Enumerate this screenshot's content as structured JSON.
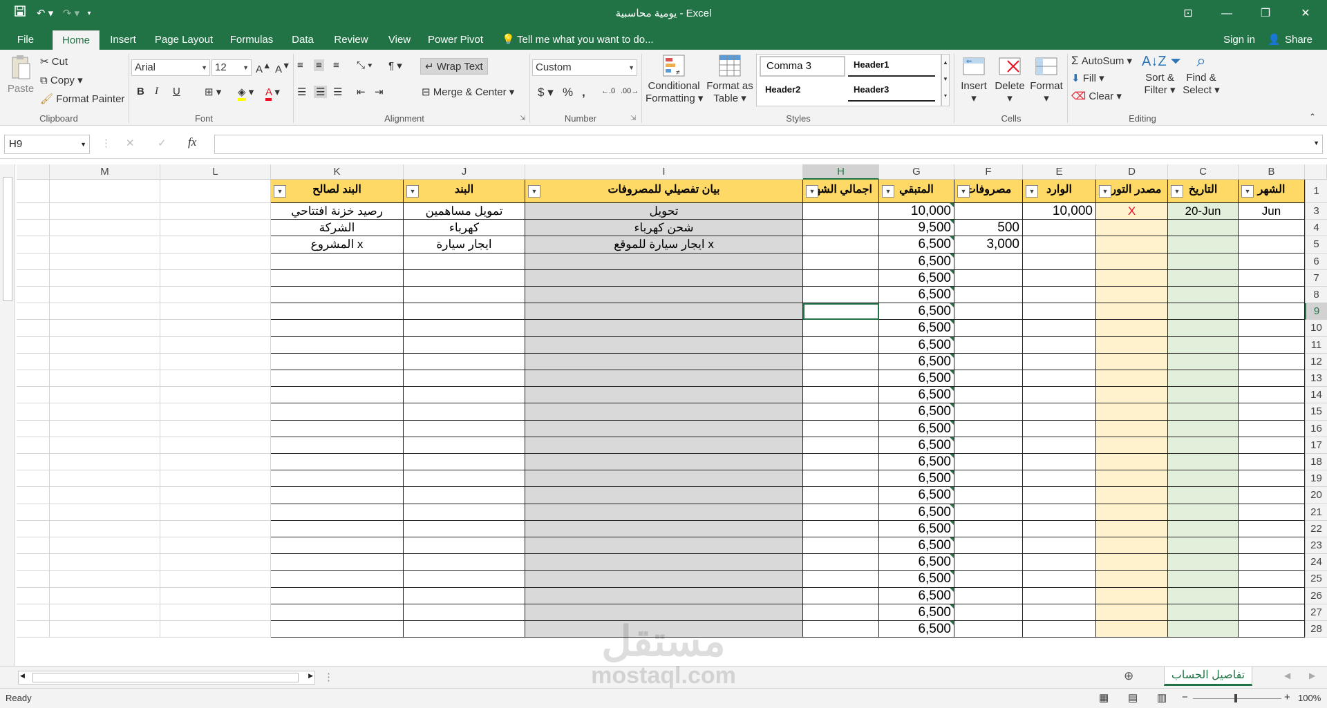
{
  "window": {
    "title": "يومية محاسبية - Excel"
  },
  "tabs": [
    "File",
    "Home",
    "Insert",
    "Page Layout",
    "Formulas",
    "Data",
    "Review",
    "View",
    "Power Pivot"
  ],
  "tell_me": "Tell me what you want to do...",
  "account": {
    "sign_in": "Sign in",
    "share": "Share"
  },
  "ribbon": {
    "clipboard": {
      "label": "Clipboard",
      "paste": "Paste",
      "cut": "Cut",
      "copy": "Copy",
      "format_painter": "Format Painter"
    },
    "font": {
      "label": "Font",
      "name": "Arial",
      "size": "12",
      "bold": "B",
      "italic": "I",
      "underline": "U"
    },
    "alignment": {
      "label": "Alignment",
      "wrap_text": "Wrap Text",
      "merge_center": "Merge & Center"
    },
    "number": {
      "label": "Number",
      "format": "Custom",
      "currency": "$",
      "percent": "%",
      "comma": ","
    },
    "styles": {
      "label": "Styles",
      "conditional": "Conditional",
      "conditional2": "Formatting",
      "format_table": "Format as",
      "format_table2": "Table",
      "cells": [
        "Comma 3",
        "Header1",
        "Header2",
        "Header3"
      ]
    },
    "cells": {
      "label": "Cells",
      "insert": "Insert",
      "delete": "Delete",
      "format": "Format"
    },
    "editing": {
      "label": "Editing",
      "autosum": "AutoSum",
      "fill": "Fill",
      "clear": "Clear",
      "sort": "Sort &",
      "sort2": "Filter",
      "find": "Find &",
      "find2": "Select"
    }
  },
  "formula_bar": {
    "name_box": "H9",
    "fx": "fx",
    "value": ""
  },
  "grid": {
    "columns": [
      "M",
      "L",
      "K",
      "J",
      "I",
      "H",
      "G",
      "F",
      "E",
      "D",
      "C",
      "B"
    ],
    "selected_column": "H",
    "header_row": {
      "K": "البند لصالح",
      "J": "البند",
      "I": "بيان تفصيلي للمصروفات",
      "H": "اجمالي الشهر",
      "G": "المتبقي",
      "F": "مصروفات",
      "E": "الوارد",
      "D": "مصدر التوريد",
      "C": "التاريخ",
      "B": "الشهر"
    },
    "row_numbers": [
      "1",
      "3",
      "4",
      "5",
      "6",
      "7",
      "8",
      "9",
      "10",
      "11",
      "12",
      "13",
      "14",
      "15",
      "16",
      "17",
      "18",
      "19",
      "20",
      "21",
      "22",
      "23",
      "24",
      "25",
      "26",
      "27",
      "28"
    ],
    "selected_row": "9",
    "data_rows": [
      {
        "K": "رصيد خزنة افتتاحي",
        "J": "تمويل مساهمين",
        "I": "تحويل",
        "G": "10,000",
        "E": "10,000",
        "D": "X",
        "C": "20-Jun",
        "B": "Jun"
      },
      {
        "K": "الشركة",
        "J": "كهرباء",
        "I": "شحن كهرباء",
        "G": "9,500",
        "F": "500"
      },
      {
        "K": "المشروع x",
        "J": "ايجار سيارة",
        "I": "ايجار سيارة للموقع x",
        "G": "6,500",
        "F": "3,000"
      }
    ],
    "repeated_remaining": "6,500"
  },
  "sheet_tab": "تفاصيل الحساب",
  "status": {
    "ready": "Ready",
    "zoom": "100%"
  },
  "watermark": {
    "line1": "مستقل",
    "line2": "mostaql.com"
  }
}
